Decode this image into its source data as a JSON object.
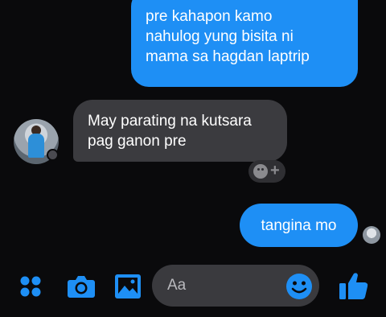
{
  "messages": [
    {
      "direction": "outgoing",
      "text": "pre kahapon kamo\nnahulog yung bisita ni\nmama sa hagdan laptrip"
    },
    {
      "direction": "incoming",
      "text": "May parating na kutsara\npag ganon pre"
    },
    {
      "direction": "outgoing",
      "text": "tangina mo"
    }
  ],
  "composer": {
    "placeholder": "Aa"
  },
  "colors": {
    "background": "#0a0a0c",
    "accent": "#1e8ff5",
    "incoming_bubble": "#3b3b3f",
    "input_bg": "#3a3a3e"
  },
  "icons": [
    "apps-icon",
    "camera-icon",
    "image-icon",
    "emoji-icon",
    "like-icon",
    "add-reaction-icon"
  ]
}
